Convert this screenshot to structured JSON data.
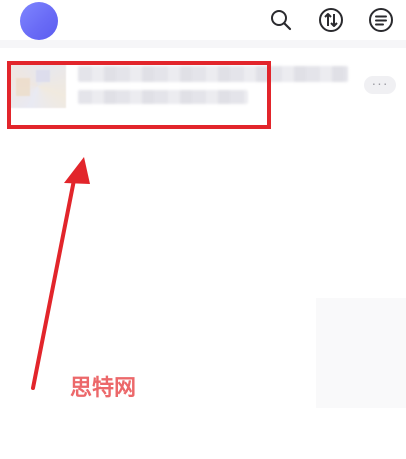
{
  "header": {
    "avatar_icon": "user-avatar",
    "actions": [
      {
        "icon": "search-icon"
      },
      {
        "icon": "sort-arrows-icon"
      },
      {
        "icon": "menu-lines-icon"
      }
    ]
  },
  "list": {
    "items": [
      {
        "title": "",
        "subtitle": "",
        "more_label": "···"
      }
    ]
  },
  "annotation": {
    "box_color": "#e2252b",
    "arrow_color": "#e2252b",
    "watermark": "思特网"
  },
  "colors": {
    "accent": "#6a6cf6",
    "background": "#f6f6f8"
  }
}
